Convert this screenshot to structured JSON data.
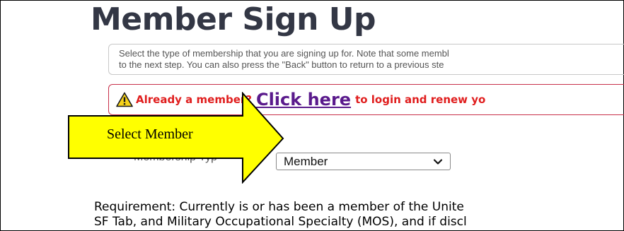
{
  "page": {
    "title": "Member Sign Up"
  },
  "instructions": {
    "line1": "Select the type of membership that you are signing up for. Note that some membl",
    "line2": "to the next step. You can also press the \"Back\" button to return to a previous ste"
  },
  "alert": {
    "icon": "warning-icon",
    "text_before": "Already a member?",
    "link_label": "Click here",
    "text_after": "to login and renew yo"
  },
  "form": {
    "membership_type_label": "Membership Typ",
    "membership_type_value": "Member"
  },
  "callout": {
    "label": "Select Member",
    "color": "#ffff00"
  },
  "requirement": {
    "line1": "Requirement: Currently is or has been a member of the Unite",
    "line2": "SF Tab, and Military Occupational Specialty (MOS), and if discl"
  },
  "colors": {
    "title": "#333745",
    "alert_border": "#c8304a",
    "alert_text": "#e01e1e",
    "link": "#5a1a8c"
  }
}
